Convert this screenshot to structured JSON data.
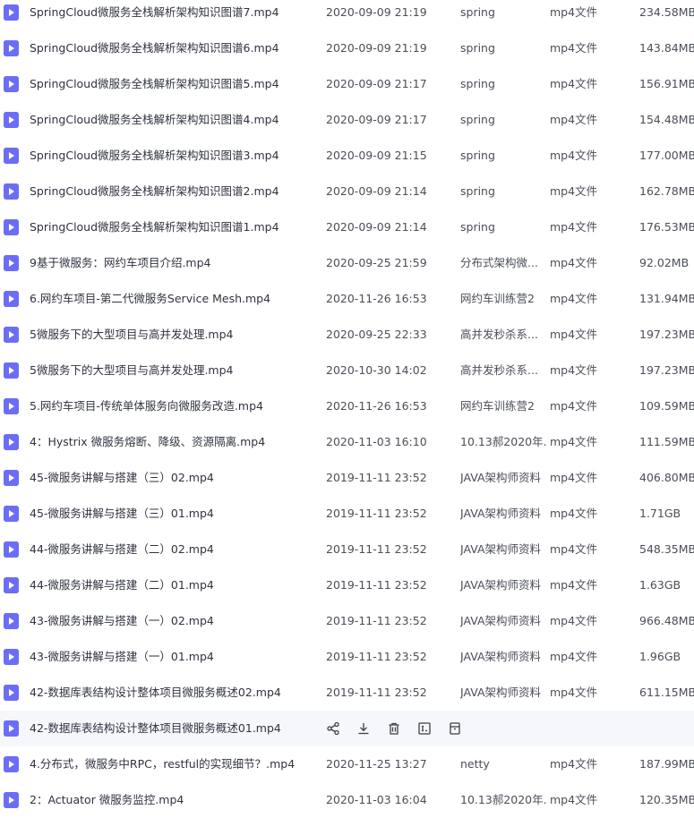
{
  "colors": {
    "file_icon": "#6b6ef5",
    "row_hover": "#f5f7fb",
    "text": "#2f3340"
  },
  "icons": {
    "file": "video-file-icon",
    "actions": [
      "share-icon",
      "download-icon",
      "delete-icon",
      "rename-icon",
      "more-icon"
    ]
  },
  "files": [
    {
      "name": "SpringCloud微服务全栈解析架构知识图谱7.mp4",
      "date": "2020-09-09 21:19",
      "dir": "spring",
      "type": "mp4文件",
      "size": "234.58MB"
    },
    {
      "name": "SpringCloud微服务全栈解析架构知识图谱6.mp4",
      "date": "2020-09-09 21:19",
      "dir": "spring",
      "type": "mp4文件",
      "size": "143.84MB"
    },
    {
      "name": "SpringCloud微服务全栈解析架构知识图谱5.mp4",
      "date": "2020-09-09 21:17",
      "dir": "spring",
      "type": "mp4文件",
      "size": "156.91MB"
    },
    {
      "name": "SpringCloud微服务全栈解析架构知识图谱4.mp4",
      "date": "2020-09-09 21:17",
      "dir": "spring",
      "type": "mp4文件",
      "size": "154.48MB"
    },
    {
      "name": "SpringCloud微服务全栈解析架构知识图谱3.mp4",
      "date": "2020-09-09 21:15",
      "dir": "spring",
      "type": "mp4文件",
      "size": "177.00MB"
    },
    {
      "name": "SpringCloud微服务全栈解析架构知识图谱2.mp4",
      "date": "2020-09-09 21:14",
      "dir": "spring",
      "type": "mp4文件",
      "size": "162.78MB"
    },
    {
      "name": "SpringCloud微服务全栈解析架构知识图谱1.mp4",
      "date": "2020-09-09 21:14",
      "dir": "spring",
      "type": "mp4文件",
      "size": "176.53MB"
    },
    {
      "name": "9基于微服务：网约车项目介绍.mp4",
      "date": "2020-09-25 21:59",
      "dir": "分布式架构微...",
      "type": "mp4文件",
      "size": "92.02MB"
    },
    {
      "name": "6.网约车项目-第二代微服务Service Mesh.mp4",
      "date": "2020-11-26 16:53",
      "dir": "网约车训练营2",
      "type": "mp4文件",
      "size": "131.94MB"
    },
    {
      "name": "5微服务下的大型项目与高并发处理.mp4",
      "date": "2020-09-25 22:33",
      "dir": "高并发秒杀系...",
      "type": "mp4文件",
      "size": "197.23MB"
    },
    {
      "name": "5微服务下的大型项目与高并发处理.mp4",
      "date": "2020-10-30 14:02",
      "dir": "高并发秒杀系...",
      "type": "mp4文件",
      "size": "197.23MB"
    },
    {
      "name": "5.网约车项目-传统单体服务向微服务改造.mp4",
      "date": "2020-11-26 16:53",
      "dir": "网约车训练营2",
      "type": "mp4文件",
      "size": "109.59MB"
    },
    {
      "name": "4：Hystrix 微服务熔断、降级、资源隔离.mp4",
      "date": "2020-11-03 16:10",
      "dir": "10.13郝2020年...",
      "type": "mp4文件",
      "size": "111.59MB"
    },
    {
      "name": "45-微服务讲解与搭建（三）02.mp4",
      "date": "2019-11-11 23:52",
      "dir": "JAVA架构师资料",
      "type": "mp4文件",
      "size": "406.80MB"
    },
    {
      "name": "45-微服务讲解与搭建（三）01.mp4",
      "date": "2019-11-11 23:52",
      "dir": "JAVA架构师资料",
      "type": "mp4文件",
      "size": "1.71GB"
    },
    {
      "name": "44-微服务讲解与搭建（二）02.mp4",
      "date": "2019-11-11 23:52",
      "dir": "JAVA架构师资料",
      "type": "mp4文件",
      "size": "548.35MB"
    },
    {
      "name": "44-微服务讲解与搭建（二）01.mp4",
      "date": "2019-11-11 23:52",
      "dir": "JAVA架构师资料",
      "type": "mp4文件",
      "size": "1.63GB"
    },
    {
      "name": "43-微服务讲解与搭建（一）02.mp4",
      "date": "2019-11-11 23:52",
      "dir": "JAVA架构师资料",
      "type": "mp4文件",
      "size": "966.48MB"
    },
    {
      "name": "43-微服务讲解与搭建（一）01.mp4",
      "date": "2019-11-11 23:52",
      "dir": "JAVA架构师资料",
      "type": "mp4文件",
      "size": "1.96GB"
    },
    {
      "name": "42-数据库表结构设计整体项目微服务概述02.mp4",
      "date": "2019-11-11 23:52",
      "dir": "JAVA架构师资料",
      "type": "mp4文件",
      "size": "611.15MB"
    },
    {
      "name": "42-数据库表结构设计整体项目微服务概述01.mp4",
      "hovered": true
    },
    {
      "name": "4.分布式，微服务中RPC，restful的实现细节？.mp4",
      "date": "2020-11-25 13:27",
      "dir": "netty",
      "type": "mp4文件",
      "size": "187.99MB"
    },
    {
      "name": "2：Actuator 微服务监控.mp4",
      "date": "2020-11-03 16:04",
      "dir": "10.13郝2020年...",
      "type": "mp4文件",
      "size": "120.35MB"
    }
  ]
}
